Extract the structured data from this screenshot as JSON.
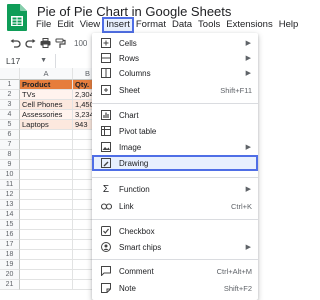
{
  "doc": {
    "title": "Pie of Pie Chart in Google Sheets"
  },
  "menubar": [
    "File",
    "Edit",
    "View",
    "Insert",
    "Format",
    "Data",
    "Tools",
    "Extensions",
    "Help"
  ],
  "toolbar": {
    "zoom": "100"
  },
  "namebox": {
    "cell": "L17"
  },
  "columns": [
    "A",
    "B"
  ],
  "rows": [
    "1",
    "2",
    "3",
    "4",
    "5",
    "6",
    "7",
    "8",
    "9",
    "10",
    "11",
    "12",
    "13",
    "14",
    "15",
    "16",
    "17",
    "18",
    "19",
    "20",
    "21"
  ],
  "table": {
    "headers": [
      "Product",
      "Qty."
    ],
    "data": [
      [
        "TVs",
        "2,304"
      ],
      [
        "Cell Phones",
        "1,450"
      ],
      [
        "Assessories",
        "3,234"
      ],
      [
        "Laptops",
        "943"
      ]
    ]
  },
  "insert_menu": {
    "items": [
      {
        "label": "Cells",
        "icon": "plus-box-icon",
        "shortcut": "",
        "submenu": true
      },
      {
        "label": "Rows",
        "icon": "rows-icon",
        "shortcut": "",
        "submenu": true
      },
      {
        "label": "Columns",
        "icon": "columns-icon",
        "shortcut": "",
        "submenu": true
      },
      {
        "label": "Sheet",
        "icon": "sheet-icon",
        "shortcut": "Shift+F11",
        "submenu": false
      },
      {
        "label": "Chart",
        "icon": "chart-icon",
        "shortcut": "",
        "submenu": false
      },
      {
        "label": "Pivot table",
        "icon": "pivot-table-icon",
        "shortcut": "",
        "submenu": false
      },
      {
        "label": "Image",
        "icon": "image-icon",
        "shortcut": "",
        "submenu": true
      },
      {
        "label": "Drawing",
        "icon": "drawing-icon",
        "shortcut": "",
        "submenu": false,
        "highlighted": true
      },
      {
        "label": "Function",
        "icon": "sigma-icon",
        "shortcut": "",
        "submenu": true
      },
      {
        "label": "Link",
        "icon": "link-icon",
        "shortcut": "Ctrl+K",
        "submenu": false
      },
      {
        "label": "Checkbox",
        "icon": "checkbox-icon",
        "shortcut": "",
        "submenu": false
      },
      {
        "label": "Smart chips",
        "icon": "smart-chips-icon",
        "shortcut": "",
        "submenu": true
      },
      {
        "label": "Comment",
        "icon": "comment-icon",
        "shortcut": "Ctrl+Alt+M",
        "submenu": false
      },
      {
        "label": "Note",
        "icon": "note-icon",
        "shortcut": "Shift+F2",
        "submenu": false
      }
    ]
  },
  "colors": {
    "accent": "#4f6ee6",
    "header_fill": "#e67d3c",
    "row_fill_light": "#fce8de",
    "row_fill_lighter": "#fff3ee",
    "sheets_green": "#0f9d58"
  }
}
